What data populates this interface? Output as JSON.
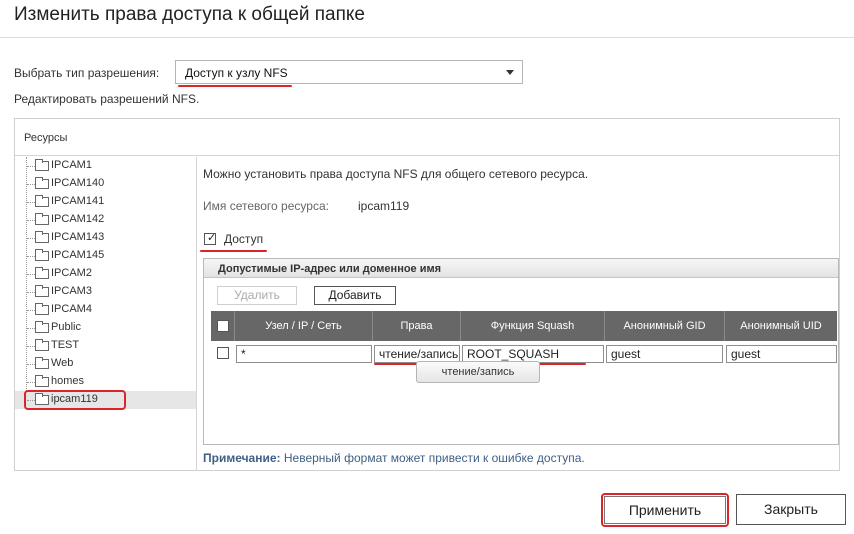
{
  "dialog": {
    "title": "Изменить права доступа к общей папке"
  },
  "permission_type": {
    "label": "Выбрать тип разрешения:",
    "selected": "Доступ к узлу NFS",
    "subtitle": "Редактировать разрешений NFS."
  },
  "resources": {
    "header": "Ресурсы",
    "tree": [
      {
        "label": "IPCAM1"
      },
      {
        "label": "IPCAM140"
      },
      {
        "label": "IPCAM141"
      },
      {
        "label": "IPCAM142"
      },
      {
        "label": "IPCAM143"
      },
      {
        "label": "IPCAM145"
      },
      {
        "label": "IPCAM2"
      },
      {
        "label": "IPCAM3"
      },
      {
        "label": "IPCAM4"
      },
      {
        "label": "Public"
      },
      {
        "label": "TEST"
      },
      {
        "label": "Web"
      },
      {
        "label": "homes"
      },
      {
        "label": "ipcam119",
        "selected": true
      }
    ]
  },
  "nfs": {
    "info": "Можно установить права доступа NFS для общего сетевого ресурса.",
    "share_name_label": "Имя сетевого ресурса:",
    "share_name_value": "ipcam119",
    "access_label": "Доступ",
    "access_checked": true,
    "allowed_title": "Допустимые IP-адрес или доменное имя",
    "delete_label": "Удалить",
    "add_label": "Добавить",
    "columns": [
      "Узел / IP / Сеть",
      "Права",
      "Функция Squash",
      "Анонимный GID",
      "Анонимный UID"
    ],
    "row": {
      "host": "*",
      "rights": "чтение/запись",
      "squash": "ROOT_SQUASH",
      "gid": "guest",
      "uid": "guest"
    },
    "dropdown_option": "чтение/запись"
  },
  "note": {
    "label": "Примечание:",
    "text": "Неверный формат может привести к ошибке доступа."
  },
  "buttons": {
    "apply": "Применить",
    "close": "Закрыть"
  },
  "colors": {
    "highlight_red": "#d9262b",
    "header_gray": "#676767",
    "note_blue": "#3f5f86"
  }
}
